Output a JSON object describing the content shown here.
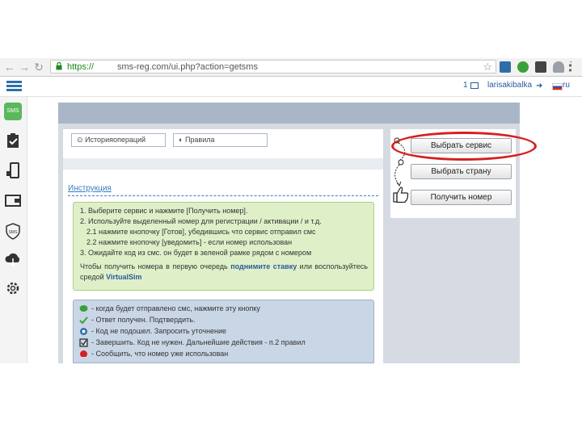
{
  "browser": {
    "url_scheme": "https://",
    "url_rest": "sms-reg.com/ui.php?action=getsms",
    "star_icon": "star-icon"
  },
  "topbar": {
    "count": "1",
    "user": "larisakibalka",
    "lang": "ru"
  },
  "sidebar": {
    "icons": [
      "sms-logo-icon",
      "clipboard-icon",
      "phone-icon",
      "wallet-icon",
      "shield-sms-icon",
      "cloud-download-icon",
      "gear-icon"
    ]
  },
  "panel": {
    "history_button": "Историяопераций",
    "rules_button": "Правила",
    "instructions_title": "Инструкция",
    "steps": [
      "1. Выберите сервис и нажмите [Получить номер].",
      "2. Используйте выделенный номер для регистрации / активации / и т.д.",
      "2.1 нажмите кнопочку [Готов], убедившись что сервис отправил смс",
      "2.2 нажмите кнопочку [уведомить] - если номер использован",
      "3. Ожидайте код из смс. он будет в зеленой рамке рядом с номером"
    ],
    "para_start": "Чтобы получить номера в первую очередь",
    "para_link": "поднимите ставку",
    "para_mid": "или воспользуйтесь средой",
    "para_link2": "VirtualSim",
    "legend": [
      "- когда будет отправлено смс, нажмите эту кнопку",
      "- Ответ получен. Подтвердить.",
      "- Код не подошел. Запросить уточнение",
      "- Завершить. Код не нужен. Дальнейшие действия - п.2 правил",
      "- Сообщить, что номер уже использован"
    ]
  },
  "steps_box": {
    "choose_service": "Выбрать сервис",
    "choose_country": "Выбрать страну",
    "get_number": "Получить номер"
  },
  "colors": {
    "accent": "#2d6ea8",
    "highlight": "#d81e1e",
    "green_box": "#dff0c8",
    "blue_box": "#c9d6e6"
  }
}
